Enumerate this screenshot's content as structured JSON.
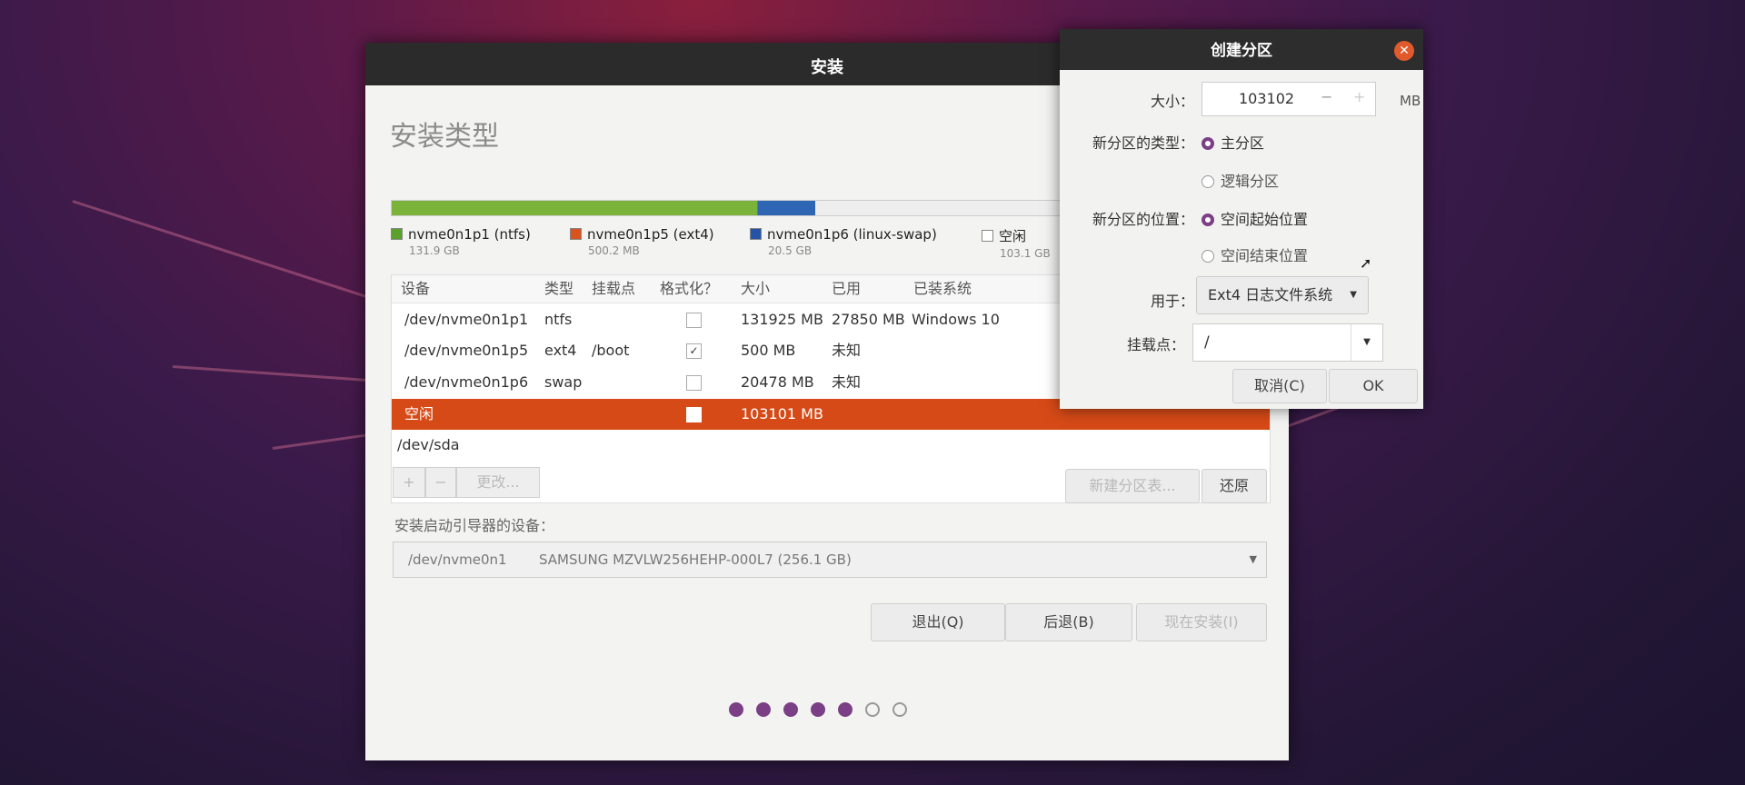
{
  "window": {
    "title": "安装",
    "heading": "安装类型"
  },
  "usage_bar": {
    "segments": [
      {
        "name": "nvme0n1p1 (ntfs)",
        "color": "#7bb33a",
        "fraction": 0.515
      },
      {
        "name": "nvme0n1p5 (ext4)",
        "color": "#d9531e",
        "fraction": 0.002
      },
      {
        "name": "nvme0n1p6 (linux-swap)",
        "color": "#2f66b3",
        "fraction": 0.08
      },
      {
        "name": "空闲",
        "color": "#eeeeee",
        "fraction": 0.403
      }
    ]
  },
  "legend": [
    {
      "label": "nvme0n1p1 (ntfs)",
      "size": "131.9 GB",
      "color": "#5aa02c"
    },
    {
      "label": "nvme0n1p5 (ext4)",
      "size": "500.2 MB",
      "color": "#d9531e"
    },
    {
      "label": "nvme0n1p6 (linux-swap)",
      "size": "20.5 GB",
      "color": "#2453a8"
    },
    {
      "label": "空闲",
      "size": "103.1 GB",
      "color": "#ffffff"
    }
  ],
  "table": {
    "headers": [
      "设备",
      "类型",
      "挂载点",
      "格式化？",
      "大小",
      "已用",
      "已装系统"
    ],
    "rows": [
      {
        "device": "/dev/nvme0n1p1",
        "type": "ntfs",
        "mount": "",
        "format": false,
        "size": "131925 MB",
        "used": "27850 MB",
        "system": "Windows 10",
        "selected": false
      },
      {
        "device": "/dev/nvme0n1p5",
        "type": "ext4",
        "mount": "/boot",
        "format": true,
        "size": "500 MB",
        "used": "未知",
        "system": "",
        "selected": false
      },
      {
        "device": "/dev/nvme0n1p6",
        "type": "swap",
        "mount": "",
        "format": false,
        "size": "20478 MB",
        "used": "未知",
        "system": "",
        "selected": false
      },
      {
        "device": "空闲",
        "type": "",
        "mount": "",
        "format": false,
        "size": "103101 MB",
        "used": "",
        "system": "",
        "selected": true
      },
      {
        "device": "/dev/sda",
        "type": "",
        "mount": "",
        "format": null,
        "size": "",
        "used": "",
        "system": "",
        "selected": false
      }
    ]
  },
  "controls": {
    "add": "+",
    "remove": "−",
    "change": "更改...",
    "new_table": "新建分区表...",
    "revert": "还原"
  },
  "bootloader": {
    "label": "安装启动引导器的设备：",
    "device": "/dev/nvme0n1",
    "model": "SAMSUNG MZVLW256HEHP-000L7 (256.1 GB)"
  },
  "nav": {
    "quit": "退出(Q)",
    "back": "后退(B)",
    "install_now": "现在安装(I)"
  },
  "progress": {
    "total_steps": 7,
    "completed_steps": 5
  },
  "dialog": {
    "title": "创建分区",
    "size_label": "大小：",
    "size_value": "103102",
    "size_minus": "−",
    "size_plus": "+",
    "size_unit": "MB",
    "type_label": "新分区的类型：",
    "type_primary": "主分区",
    "type_logical": "逻辑分区",
    "location_label": "新分区的位置：",
    "location_start": "空间起始位置",
    "location_end": "空间结束位置",
    "use_label": "用于：",
    "use_value": "Ext4 日志文件系统",
    "mount_label": "挂载点：",
    "mount_value": "/",
    "cancel": "取消(C)",
    "ok": "OK"
  },
  "colors": {
    "accent": "#7b3f86",
    "selected_row": "#d64a17",
    "close_button": "#e05a2c"
  }
}
